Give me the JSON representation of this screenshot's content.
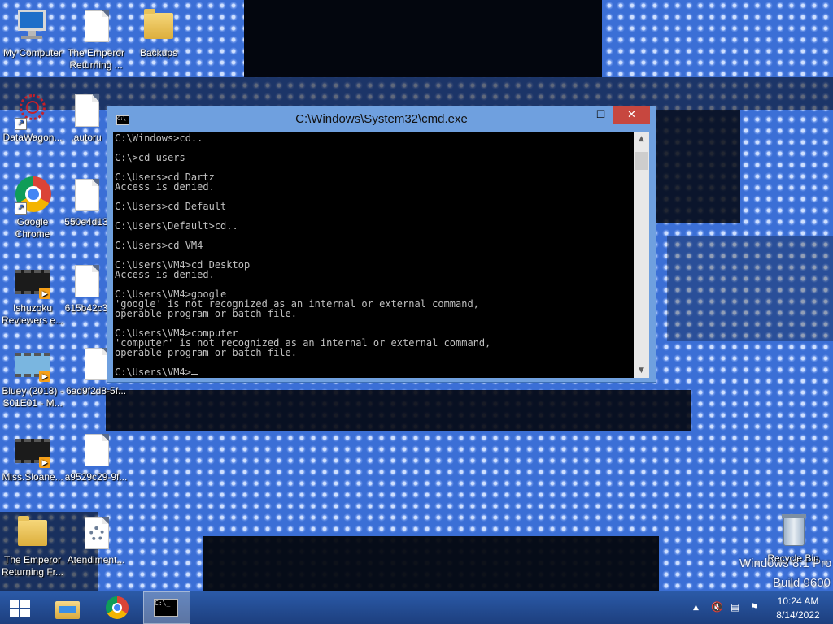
{
  "window": {
    "title": "C:\\Windows\\System32\\cmd.exe",
    "icon": "cmd-icon",
    "console_lines": [
      "C:\\Windows>cd..",
      "",
      "C:\\>cd users",
      "",
      "C:\\Users>cd Dartz",
      "Access is denied.",
      "",
      "C:\\Users>cd Default",
      "",
      "C:\\Users\\Default>cd..",
      "",
      "C:\\Users>cd VM4",
      "",
      "C:\\Users\\VM4>cd Desktop",
      "Access is denied.",
      "",
      "C:\\Users\\VM4>google",
      "'google' is not recognized as an internal or external command,",
      "operable program or batch file.",
      "",
      "C:\\Users\\VM4>computer",
      "'computer' is not recognized as an internal or external command,",
      "operable program or batch file.",
      ""
    ],
    "prompt": "C:\\Users\\VM4>",
    "controls": {
      "minimize": "—",
      "maximize": "☐",
      "close": "✕"
    }
  },
  "desktop_icons": [
    {
      "label": "My Computer",
      "icon": "computer-icon"
    },
    {
      "label": "The Emperor Returning ...",
      "icon": "document-icon"
    },
    {
      "label": "Backups",
      "icon": "folder-icon"
    },
    {
      "label": "DataWagon...",
      "icon": "datawagon-icon"
    },
    {
      "label": ".autoru",
      "icon": "document-icon"
    },
    {
      "label": "Google Chrome",
      "icon": "chrome-icon"
    },
    {
      "label": "550e4d13",
      "icon": "document-icon"
    },
    {
      "label": "Ishuzoku Reviewers e...",
      "icon": "video-icon"
    },
    {
      "label": "615b42c3",
      "icon": "document-icon"
    },
    {
      "label": "Bluey (2018) - S01E01 - M...",
      "icon": "video-icon"
    },
    {
      "label": "6ad9f2d8-5f...",
      "icon": "document-icon"
    },
    {
      "label": "Miss.Sloane...",
      "icon": "video-icon"
    },
    {
      "label": "a9529c29-9f...",
      "icon": "document-icon"
    },
    {
      "label": "The Emperor Returning Fr...",
      "icon": "folder-icon"
    },
    {
      "label": "Atendiment...",
      "icon": "settings-document-icon"
    },
    {
      "label": "Recycle Bin",
      "icon": "recycle-bin-icon"
    }
  ],
  "watermark": {
    "line1": "Windows 8.1 Pro",
    "line2": "Build 9600"
  },
  "taskbar": {
    "items": [
      "start-icon",
      "file-explorer-icon",
      "chrome-icon",
      "cmd-icon"
    ],
    "tray_icons": [
      "show-hidden-icons-icon",
      "volume-muted-icon",
      "network-icon",
      "action-center-icon"
    ],
    "time": "10:24 AM",
    "date": "8/14/2022"
  }
}
